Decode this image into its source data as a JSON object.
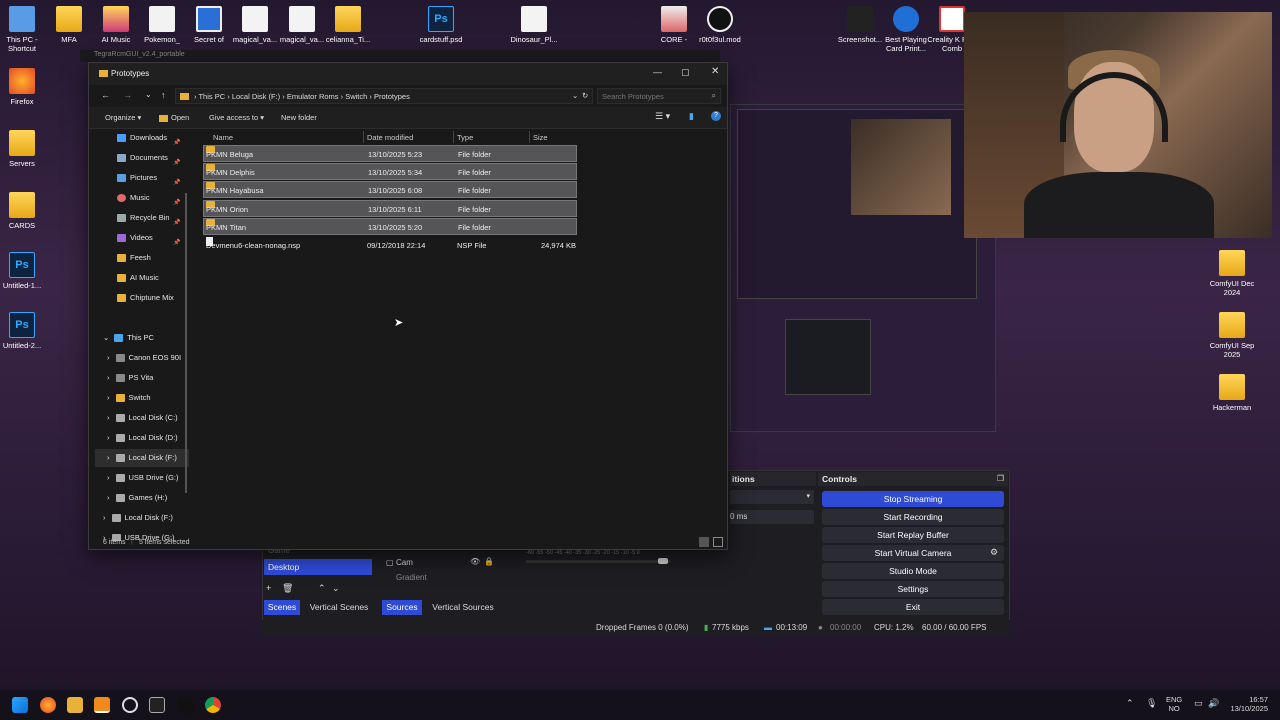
{
  "desktop": {
    "left_icons": [
      {
        "label": "This PC - Shortcut",
        "icon": "pc-icon"
      },
      {
        "label": "Firefox",
        "icon": "firefox-icon"
      },
      {
        "label": "Servers",
        "icon": "folder-icon"
      },
      {
        "label": "CARDS",
        "icon": "folder-icon"
      },
      {
        "label": "Untitled-1...",
        "icon": "psd-icon"
      },
      {
        "label": "Untitled-2...",
        "icon": "psd-icon"
      }
    ],
    "top_icons": [
      {
        "label": "MFA",
        "icon": "folder-icon"
      },
      {
        "label": "AI Music",
        "icon": "folder-icon"
      },
      {
        "label": "Pokemon_",
        "icon": "image-icon"
      },
      {
        "label": "Secret of",
        "icon": "image-icon"
      },
      {
        "label": "magical_va...",
        "icon": "file-icon"
      },
      {
        "label": "magical_va...",
        "icon": "file-icon"
      },
      {
        "label": "celianna_Ti...",
        "icon": "folder-icon"
      },
      {
        "label": "cardstuff.psd",
        "icon": "psd-icon"
      },
      {
        "label": "Dinosaur_Pl...",
        "icon": "file-icon"
      },
      {
        "label": "CORE -",
        "icon": "file-icon"
      },
      {
        "label": "r0t0f3ul.mod",
        "icon": "media-icon"
      },
      {
        "label": "Screenshot...",
        "icon": "image-icon"
      },
      {
        "label": "Best Playing Card Print...",
        "icon": "nexo-icon"
      },
      {
        "label": "Creality K Plus Comb",
        "icon": "creality-icon"
      }
    ],
    "right_icons": [
      {
        "label": "ComfyUI Dec 2024",
        "icon": "folder-icon"
      },
      {
        "label": "ComfyUI Sep 2025",
        "icon": "folder-icon"
      },
      {
        "label": "Hackerman",
        "icon": "folder-icon"
      }
    ],
    "background_window_title": "TegraRcmGUI_v2.4_portable"
  },
  "explorer": {
    "title": "Prototypes",
    "breadcrumb": [
      "This PC",
      "Local Disk (F:)",
      "Emulator Roms",
      "Switch",
      "Prototypes"
    ],
    "search_placeholder": "Search Prototypes",
    "commands": {
      "organize": "Organize",
      "open": "Open",
      "give_access": "Give access to",
      "new_folder": "New folder"
    },
    "nav_items": [
      {
        "label": "Downloads",
        "pinned": true,
        "color": "#4a9eff"
      },
      {
        "label": "Documents",
        "pinned": true,
        "color": "#8aa8c8"
      },
      {
        "label": "Pictures",
        "pinned": true,
        "color": "#5aa0e0"
      },
      {
        "label": "Music",
        "pinned": true,
        "color": "#e06a6a"
      },
      {
        "label": "Recycle Bin",
        "pinned": true,
        "color": "#9aa"
      },
      {
        "label": "Videos",
        "pinned": true,
        "color": "#9b6ad6"
      },
      {
        "label": "Feesh",
        "pinned": false,
        "color": "#e8b23a"
      },
      {
        "label": "AI Music",
        "pinned": false,
        "color": "#e8b23a"
      },
      {
        "label": "Chiptune Mix",
        "pinned": false,
        "color": "#e8b23a"
      }
    ],
    "tree_items": [
      {
        "label": "This PC",
        "color": "#4aa6e8"
      },
      {
        "label": "Canon EOS 90I",
        "color": "#888"
      },
      {
        "label": "PS Vita",
        "color": "#888"
      },
      {
        "label": "Switch",
        "color": "#e8b23a"
      },
      {
        "label": "Local Disk (C:)",
        "color": "#aaa"
      },
      {
        "label": "Local Disk (D:)",
        "color": "#aaa"
      },
      {
        "label": "Local Disk (F:)",
        "color": "#aaa"
      },
      {
        "label": "USB Drive (G:)",
        "color": "#aaa"
      },
      {
        "label": "Games (H:)",
        "color": "#aaa"
      },
      {
        "label": "Local Disk (F:)",
        "color": "#aaa"
      },
      {
        "label": "USB Drive (G:)",
        "color": "#aaa"
      }
    ],
    "columns": [
      "Name",
      "Date modified",
      "Type",
      "Size"
    ],
    "files": [
      {
        "name": "PKMN Beluga",
        "date": "13/10/2025 5:23",
        "type": "File folder",
        "size": "",
        "selected": true,
        "kind": "folder"
      },
      {
        "name": "PKMN Delphis",
        "date": "13/10/2025 5:34",
        "type": "File folder",
        "size": "",
        "selected": true,
        "kind": "folder"
      },
      {
        "name": "PKMN Hayabusa",
        "date": "13/10/2025 6:08",
        "type": "File folder",
        "size": "",
        "selected": true,
        "kind": "folder"
      },
      {
        "name": "PKMN Orion",
        "date": "13/10/2025 6:11",
        "type": "File folder",
        "size": "",
        "selected": true,
        "kind": "folder"
      },
      {
        "name": "PKMN Titan",
        "date": "13/10/2025 5:20",
        "type": "File folder",
        "size": "",
        "selected": true,
        "kind": "folder"
      },
      {
        "name": "Devmenu6-clean-nonag.nsp",
        "date": "09/12/2018 22:14",
        "type": "NSP File",
        "size": "24,974 KB",
        "selected": false,
        "kind": "file"
      }
    ],
    "status": {
      "items": "6 items",
      "selected": "5 items selected"
    }
  },
  "obs": {
    "controls_title": "Controls",
    "buttons": [
      {
        "label": "Stop Streaming",
        "active": true
      },
      {
        "label": "Start Recording",
        "active": false
      },
      {
        "label": "Start Replay Buffer",
        "active": false
      },
      {
        "label": "Start Virtual Camera",
        "active": false
      },
      {
        "label": "Studio Mode",
        "active": false
      },
      {
        "label": "Settings",
        "active": false
      },
      {
        "label": "Exit",
        "active": false
      }
    ],
    "transitions_fragment": "itions",
    "duration_fragment": "0 ms",
    "scene_selected": "Desktop",
    "scene_partial": "Game",
    "sources": [
      "Cam",
      "Gradient"
    ],
    "tabs": {
      "scenes": "Scenes",
      "vertical_scenes": "Vertical Scenes",
      "sources": "Sources",
      "vertical_sources": "Vertical Sources"
    },
    "meter_ticks": "-60 -55 -50 -45 -40 -35 -30 -25 -20 -15 -10 -5 0",
    "status": {
      "dropped": "Dropped Frames 0 (0.0%)",
      "bitrate": "7775 kbps",
      "stream_time": "00:13:09",
      "rec_time": "00:00:00",
      "cpu": "CPU: 1.2%",
      "fps": "60.00 / 60.00 FPS"
    }
  },
  "taskbar": {
    "lang": "ENG",
    "lang2": "NO",
    "time": "16:57",
    "date": "13/10/2025"
  }
}
